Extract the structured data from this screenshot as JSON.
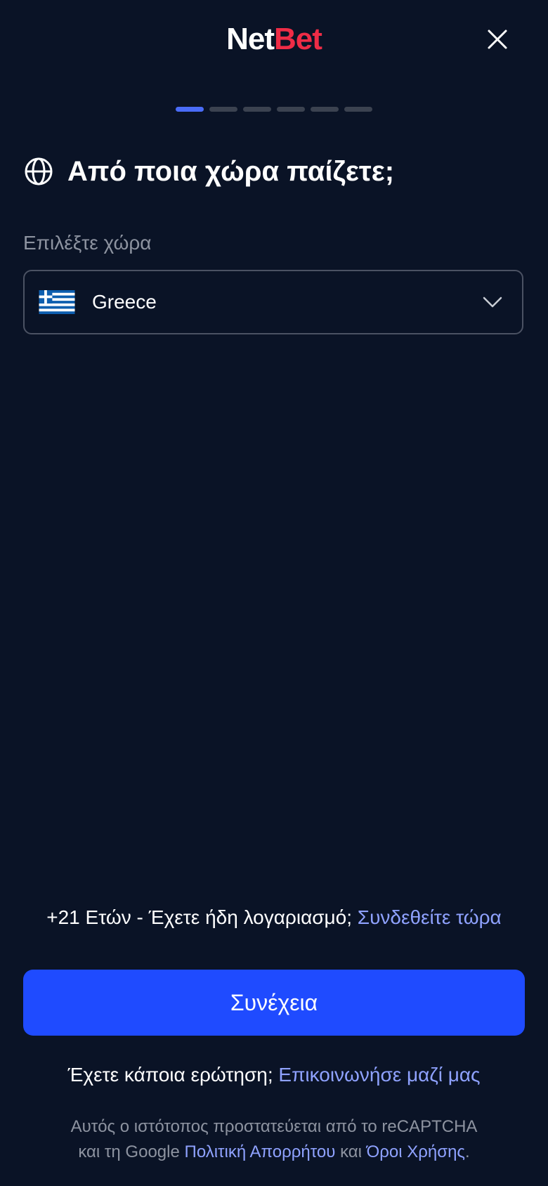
{
  "header": {
    "logo_net": "Net",
    "logo_bet": "Bet",
    "close_icon": "close-icon"
  },
  "progress": {
    "total_steps": 6,
    "current_step": 1,
    "colors": {
      "active": "#4a6cf7",
      "inactive": "#3b4250"
    }
  },
  "page": {
    "title": "Από ποια χώρα παίζετε;",
    "title_icon": "globe-icon"
  },
  "country_field": {
    "label": "Επιλέξτε χώρα",
    "selected_value": "Greece",
    "flag_icon": "greece-flag-icon",
    "dropdown_icon": "chevron-down-icon"
  },
  "login_prompt": {
    "text": "+21 Ετών - Έχετε ήδη λογαριασμό;",
    "link_label": "Συνδεθείτε τώρα"
  },
  "continue_button": {
    "label": "Συνέχεια",
    "color": "#1f4bff"
  },
  "contact_prompt": {
    "text": "Έχετε κάποια ερώτηση;",
    "link_label": "Επικοινωνήσε μαζί μας"
  },
  "recaptcha": {
    "line1": "Αυτός ο ιστότοπος προστατεύεται από το reCAPTCHA",
    "line2_prefix": "και τη Google",
    "privacy_link": "Πολιτική Απορρήτου",
    "conjunction": "και",
    "terms_link": "Όροι Χρήσης",
    "suffix": "."
  },
  "theme": {
    "background": "#0a1326",
    "link_color": "#8fa2ff",
    "brand_red": "#ef2c46"
  }
}
